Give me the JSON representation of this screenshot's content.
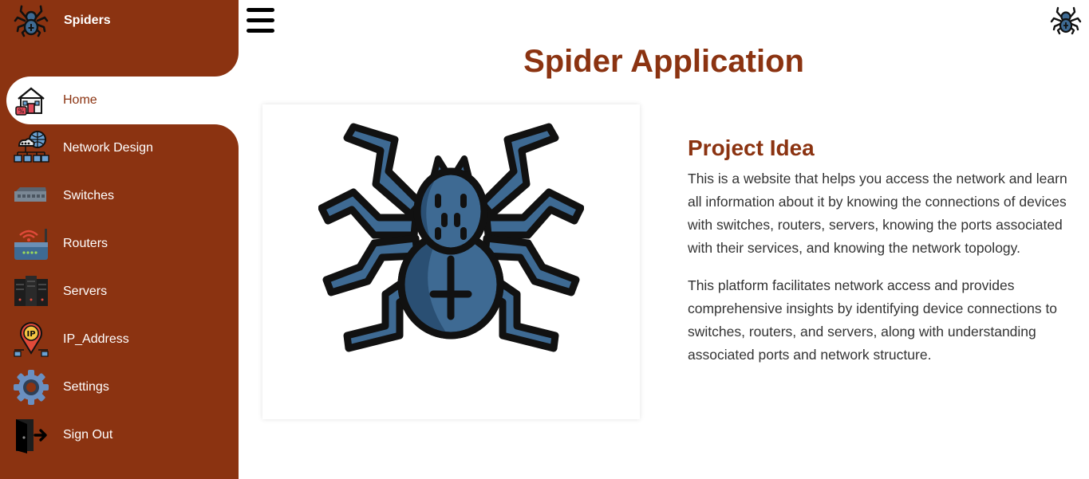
{
  "brand": {
    "name": "Spiders",
    "logo_icon": "spider-icon"
  },
  "sidebar": {
    "items": [
      {
        "label": "Home",
        "icon": "home-icon",
        "active": true
      },
      {
        "label": "Network Design",
        "icon": "network-design-icon",
        "active": false
      },
      {
        "label": "Switches",
        "icon": "switch-icon",
        "active": false
      },
      {
        "label": "Routers",
        "icon": "router-icon",
        "active": false
      },
      {
        "label": "Servers",
        "icon": "server-icon",
        "active": false
      },
      {
        "label": "IP_Address",
        "icon": "ip-address-icon",
        "active": false
      },
      {
        "label": "Settings",
        "icon": "gear-icon",
        "active": false
      },
      {
        "label": "Sign Out",
        "icon": "sign-out-icon",
        "active": false
      }
    ]
  },
  "header": {
    "menu_icon": "hamburger-icon",
    "avatar_icon": "spider-icon"
  },
  "main": {
    "title": "Spider Application",
    "section_title": "Project Idea",
    "paragraphs": [
      "This is a website that helps you access the network and learn all information about it by knowing the connections of devices with switches, routers, servers, knowing the ports associated with their services, and knowing the network topology.",
      "This platform facilitates network access and provides comprehensive insights by identifying device connections to switches, routers, and servers, along with understanding associated ports and network structure."
    ]
  },
  "colors": {
    "primary": "#8b3311",
    "spider_blue": "#3e6a93",
    "spider_dark": "#2a4f73",
    "text": "#333333"
  }
}
